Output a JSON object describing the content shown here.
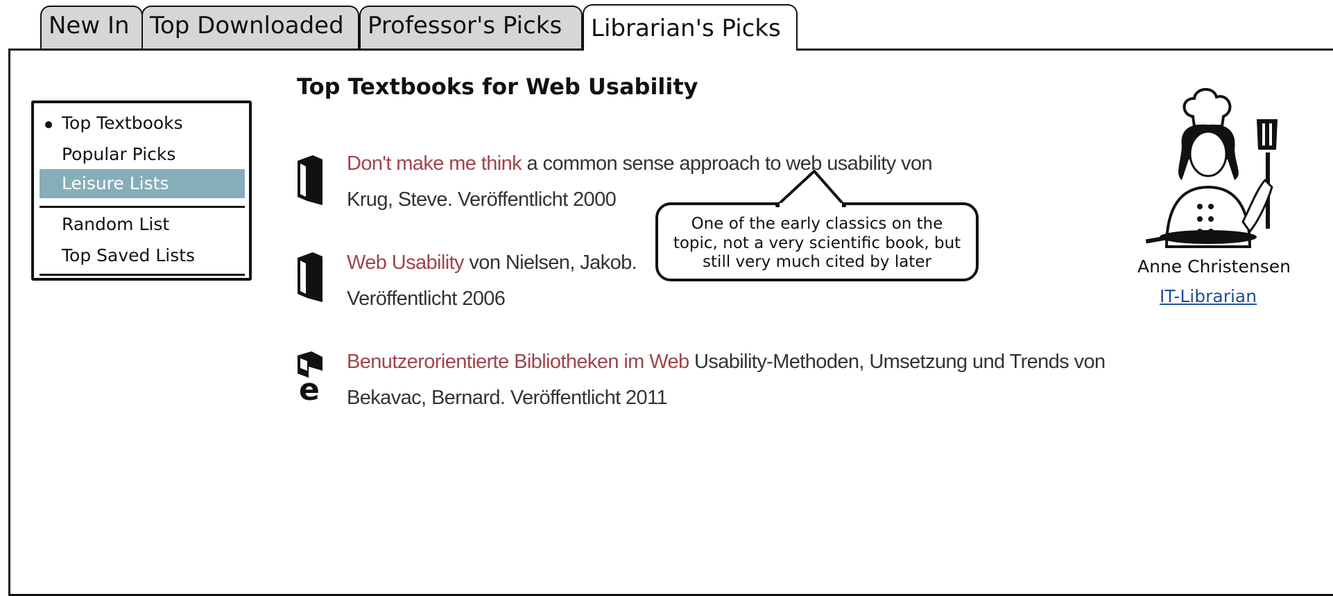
{
  "tabs": [
    {
      "label": "New In"
    },
    {
      "label": "Top Downloaded"
    },
    {
      "label": "Professor's Picks"
    },
    {
      "label": "Librarian's Picks"
    }
  ],
  "active_tab": "Librarian's Picks",
  "sidebar": {
    "items": [
      {
        "label": "Top Textbooks",
        "state": "current"
      },
      {
        "label": "Popular Picks"
      },
      {
        "label": "Leisure Lists",
        "state": "selected"
      },
      {
        "label": "Random List"
      },
      {
        "label": "Top Saved Lists"
      }
    ]
  },
  "main": {
    "heading": "Top Textbooks for Web Usability",
    "books": [
      {
        "icon": "book-icon",
        "title": "Don't make me think",
        "line1_rest": " a common sense approach to web usability von",
        "line2": "Krug, Steve. Veröffentlicht 2000"
      },
      {
        "icon": "book-icon",
        "title": "Web Usability",
        "line1_rest": " von Nielsen, Jakob.",
        "line2": "Veröffentlicht 2006"
      },
      {
        "icon": "ebook-icon",
        "title": "Benutzerorientierte Bibliotheken im Web",
        "line1_rest": " Usability-Methoden, Umsetzung und Trends von",
        "line2": "Bekavac, Bernard. Veröffentlicht 2011"
      }
    ],
    "callout": {
      "line1": "One of the early classics on the",
      "line2": "topic, not a very scientific book, but",
      "line3": "still very much cited by later"
    }
  },
  "librarian": {
    "avatar_icon": "chef-icon",
    "name": "Anne Christensen",
    "role": "IT-Librarian"
  },
  "colors": {
    "title_link": "#a0444a",
    "selected_item": "#86aeb8",
    "role_link": "#1f4e9a"
  }
}
